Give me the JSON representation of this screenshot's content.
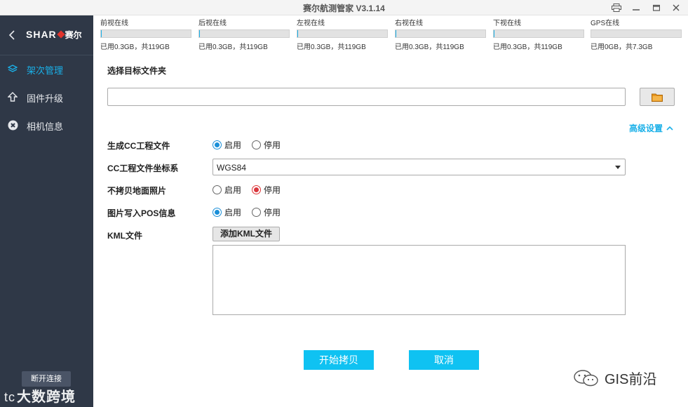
{
  "window": {
    "title": "赛尔航测管家 V3.1.14"
  },
  "sidebar": {
    "logo_text": "SHAR",
    "logo_cn": "赛尔",
    "items": [
      {
        "label": "架次管理",
        "icon": "layers-icon",
        "active": true
      },
      {
        "label": "固件升级",
        "icon": "upload-arrow-icon",
        "active": false
      },
      {
        "label": "相机信息",
        "icon": "camera-aperture-icon",
        "active": false
      }
    ],
    "disconnect_label": "断开连接",
    "watermark": "大数跨境"
  },
  "cameras": [
    {
      "name": "前视在线",
      "usage": "已用0.3GB，共119GB",
      "used_fraction": 0.0025
    },
    {
      "name": "后视在线",
      "usage": "已用0.3GB，共119GB",
      "used_fraction": 0.0025
    },
    {
      "name": "左视在线",
      "usage": "已用0.3GB，共119GB",
      "used_fraction": 0.0025
    },
    {
      "name": "右视在线",
      "usage": "已用0.3GB，共119GB",
      "used_fraction": 0.0025
    },
    {
      "name": "下视在线",
      "usage": "已用0.3GB，共119GB",
      "used_fraction": 0.0025
    },
    {
      "name": "GPS在线",
      "usage": "已用0GB，共7.3GB",
      "used_fraction": 0
    }
  ],
  "form": {
    "target_folder_label": "选择目标文件夹",
    "target_folder_value": "",
    "advanced_label": "高级设置",
    "cc_label": "生成CC工程文件",
    "cc_coord_label": "CC工程文件坐标系",
    "cc_coord_value": "WGS84",
    "no_ground_label": "不拷贝地面照片",
    "pos_label": "图片写入POS信息",
    "kml_label": "KML文件",
    "enable_label": "启用",
    "disable_label": "停用",
    "add_kml_label": "添加KML文件",
    "kml_content": ""
  },
  "actions": {
    "start_label": "开始拷贝",
    "cancel_label": "取消"
  },
  "watermark_right": "GIS前沿",
  "colors": {
    "accent": "#1ab0e8",
    "primary_button": "#0fc2f2",
    "sidebar_bg": "#2f3847"
  }
}
